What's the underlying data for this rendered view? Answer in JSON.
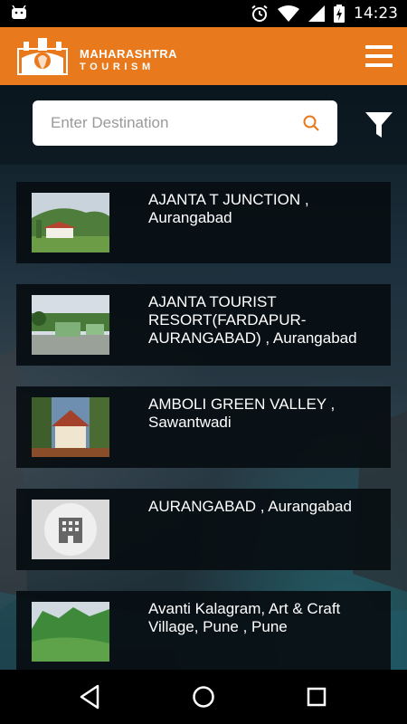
{
  "status_bar": {
    "time": "14:23",
    "icons": [
      "android-icon",
      "alarm-icon",
      "wifi-icon",
      "signal-icon",
      "battery-charging-icon"
    ]
  },
  "header": {
    "brand_line1": "MAHARASHTRA",
    "brand_line2": "TOURISM",
    "background_color": "#e87a1d"
  },
  "search": {
    "placeholder": "Enter Destination",
    "value": ""
  },
  "results": [
    {
      "title": "AJANTA T JUNCTION , Aurangabad",
      "image": "resort-photo"
    },
    {
      "title": "AJANTA TOURIST RESORT(FARDAPUR-AURANGABAD) , Aurangabad",
      "image": "resort-photo"
    },
    {
      "title": "AMBOLI GREEN VALLEY , Sawantwadi",
      "image": "resort-photo"
    },
    {
      "title": "AURANGABAD , Aurangabad",
      "image": "hotel-placeholder-icon"
    },
    {
      "title": "Avanti Kalagram, Art & Craft Village, Pune , Pune",
      "image": "landscape-photo"
    }
  ],
  "nav_bar": {
    "buttons": [
      "back-icon",
      "home-icon",
      "recents-icon"
    ]
  }
}
